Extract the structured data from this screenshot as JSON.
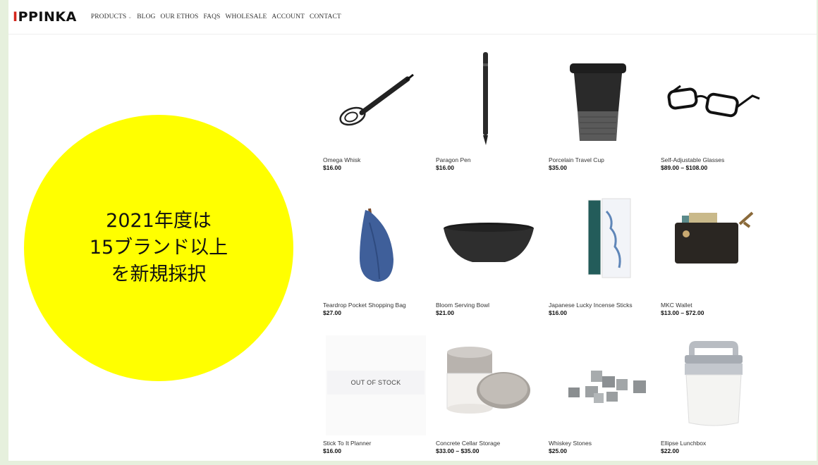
{
  "header": {
    "logo_mark": "I",
    "logo_text": "PPINKA",
    "nav": [
      "PRODUCTS",
      "BLOG",
      "OUR ETHOS",
      "FAQS",
      "WHOLESALE",
      "ACCOUNT",
      "CONTACT"
    ]
  },
  "callout": {
    "lines": [
      "2021年度は",
      "15ブランド以上",
      "を新規採択"
    ],
    "color": "#ffff00"
  },
  "products": [
    {
      "name": "Omega Whisk",
      "price": "$16.00",
      "icon": "whisk-image"
    },
    {
      "name": "Paragon Pen",
      "price": "$16.00",
      "icon": "pen-image"
    },
    {
      "name": "Porcelain Travel Cup",
      "price": "$35.00",
      "icon": "cup-image"
    },
    {
      "name": "Self-Adjustable Glasses",
      "price": "$89.00 – $108.00",
      "icon": "glasses-image"
    },
    {
      "name": "Teardrop Pocket Shopping Bag",
      "price": "$27.00",
      "icon": "bag-image"
    },
    {
      "name": "Bloom Serving Bowl",
      "price": "$21.00",
      "icon": "bowl-image"
    },
    {
      "name": "Japanese Lucky Incense Sticks",
      "price": "$16.00",
      "icon": "incense-image"
    },
    {
      "name": "MKC Wallet",
      "price": "$13.00 – $72.00",
      "icon": "wallet-image"
    },
    {
      "name": "Stick To It Planner",
      "price": "$16.00",
      "icon": "planner-image",
      "badge": "OUT OF STOCK"
    },
    {
      "name": "Concrete Cellar Storage",
      "price": "$33.00 – $35.00",
      "icon": "storage-image"
    },
    {
      "name": "Whiskey Stones",
      "price": "$25.00",
      "icon": "stones-image"
    },
    {
      "name": "Ellipse Lunchbox",
      "price": "$22.00",
      "icon": "lunchbox-image"
    }
  ]
}
